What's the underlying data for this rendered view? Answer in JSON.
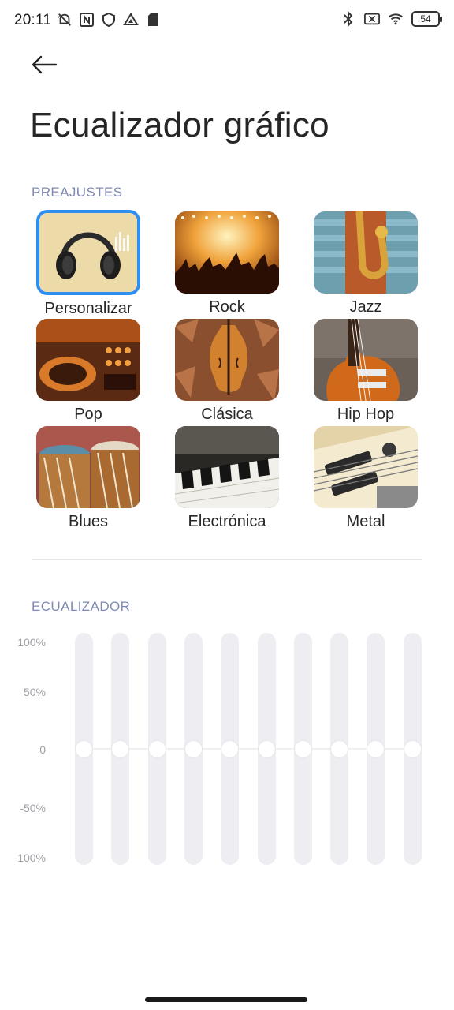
{
  "status_bar": {
    "time": "20:11",
    "battery": "54",
    "left_icons": [
      "notification-muted-icon",
      "nfc-icon",
      "shield-icon",
      "drive-icon",
      "sim-card-icon"
    ],
    "right_icons": [
      "bluetooth-icon",
      "no-sim-icon",
      "wifi-icon",
      "battery-icon"
    ]
  },
  "header": {
    "back_icon": "arrow-left-icon",
    "title": "Ecualizador gráfico"
  },
  "presets": {
    "section_label": "PREAJUSTES",
    "selected": "Personalizar",
    "items": [
      {
        "label": "Personalizar",
        "image": "headphones"
      },
      {
        "label": "Rock",
        "image": "concert-crowd"
      },
      {
        "label": "Jazz",
        "image": "saxophone"
      },
      {
        "label": "Pop",
        "image": "dj-turntable"
      },
      {
        "label": "Clásica",
        "image": "violin"
      },
      {
        "label": "Hip Hop",
        "image": "electric-guitar"
      },
      {
        "label": "Blues",
        "image": "drums"
      },
      {
        "label": "Electrónica",
        "image": "piano-keys"
      },
      {
        "label": "Metal",
        "image": "guitar-pickups"
      }
    ]
  },
  "equalizer": {
    "section_label": "ECUALIZADOR",
    "scale": [
      "100%",
      "50%",
      "0",
      "-50%",
      "-100%"
    ],
    "bands": [
      0,
      0,
      0,
      0,
      0,
      0,
      0,
      0,
      0,
      0
    ]
  },
  "colors": {
    "accent": "#2e8ff0",
    "section_label": "#7f8ab3",
    "track": "#eeeef2"
  }
}
